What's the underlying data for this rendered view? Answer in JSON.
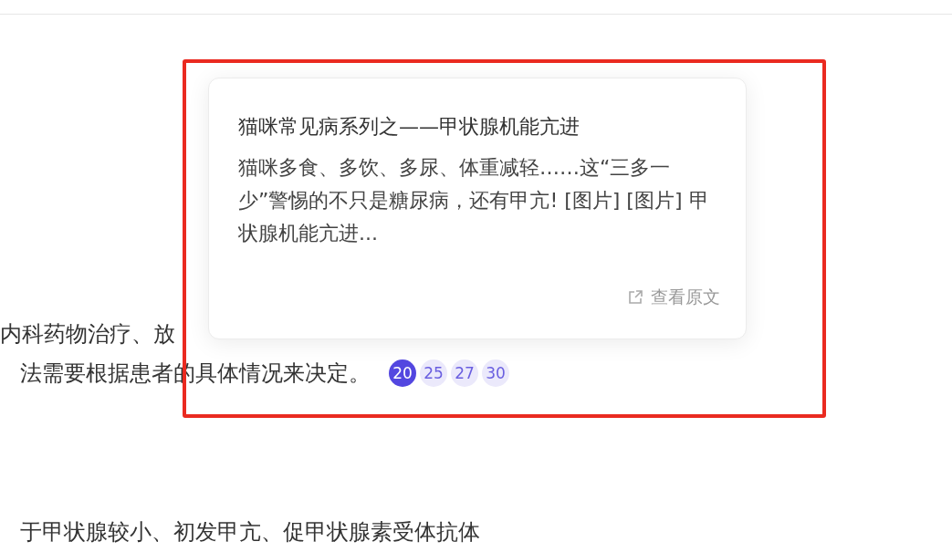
{
  "article": {
    "lines": [
      {
        "text": "内科药物治疗、放"
      },
      {
        "text": "法需要根据患者的具体情况来决定。",
        "citations": [
          {
            "label": "20",
            "selected": true
          },
          {
            "label": "25",
            "selected": false
          },
          {
            "label": "27",
            "selected": false
          },
          {
            "label": "30",
            "selected": false
          }
        ]
      },
      {
        "text": "于甲状腺较小、初发甲亢、促甲状腺素受体抗体"
      }
    ]
  },
  "popover": {
    "title": "猫咪常见病系列之——甲状腺机能亢进",
    "excerpt": "猫咪多食、多饮、多尿、体重减轻……这“三多一少”警惕的不只是糖尿病，还有甲亢! [图片] [图片] 甲状腺机能亢进...",
    "link": "查看原文"
  }
}
